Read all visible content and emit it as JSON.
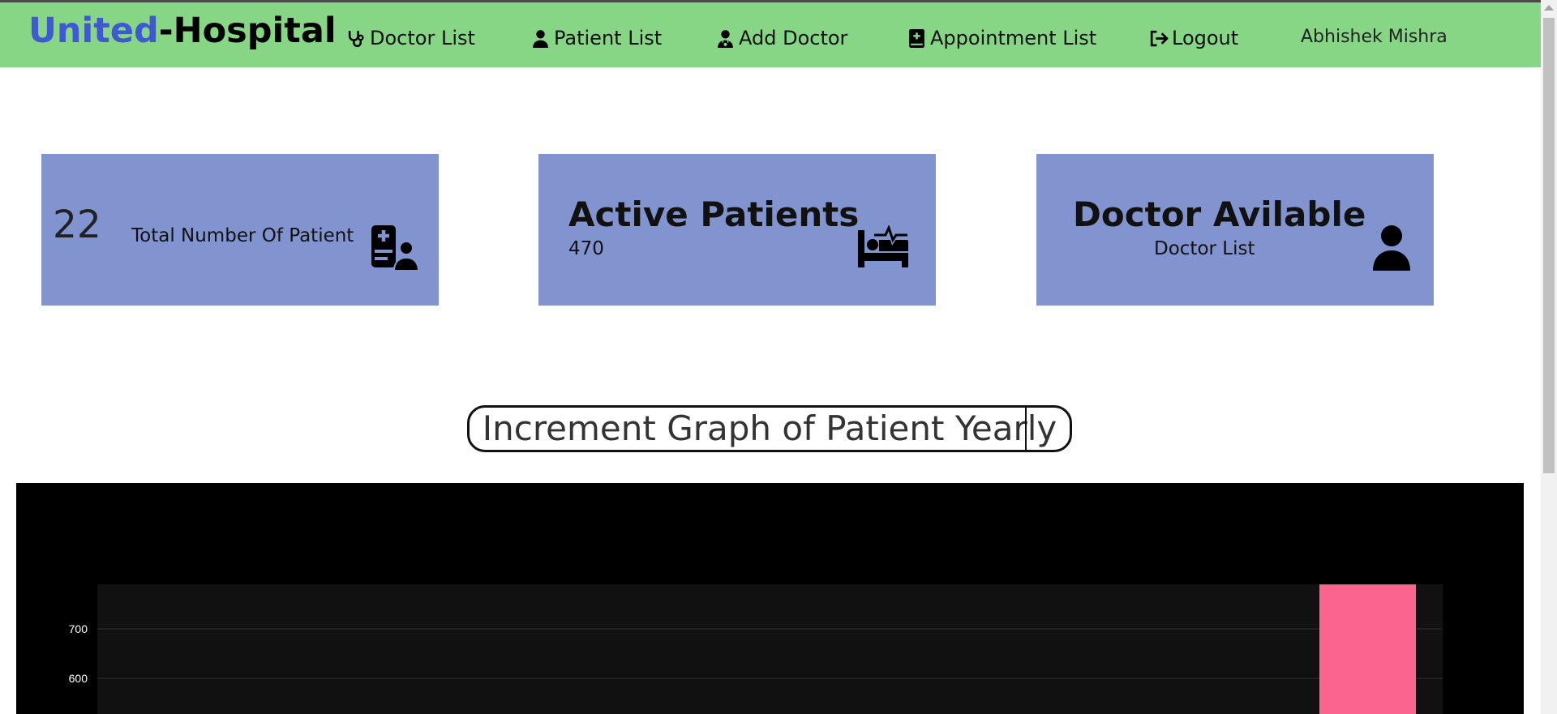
{
  "navbar": {
    "brand_part1": "United",
    "brand_part2": "-Hospital",
    "items": [
      {
        "label": "Doctor List",
        "icon": "stethoscope-icon"
      },
      {
        "label": "Patient List",
        "icon": "user-icon"
      },
      {
        "label": "Add Doctor",
        "icon": "user-doctor-icon"
      },
      {
        "label": "Appointment List",
        "icon": "medical-book-icon"
      },
      {
        "label": "Logout",
        "icon": "sign-out-icon"
      }
    ],
    "username": "Abhishek Mishra"
  },
  "cards": {
    "total_patients": {
      "value": "22",
      "label": "Total Number Of Patient",
      "icon": "hospital-user-icon"
    },
    "active_patients": {
      "title": "Active Patients",
      "value": "470",
      "icon": "bed-pulse-icon"
    },
    "doctor_available": {
      "title": "Doctor Avilable",
      "link": "Doctor List",
      "icon": "user-icon"
    }
  },
  "graph_title": "Increment Graph of Patient Yearly",
  "colors": {
    "navbar_bg": "#86d686",
    "brand_blue": "#3f58d3",
    "card_bg": "#8294cf",
    "chart_bg": "#000000",
    "plot_bg": "#111111",
    "bar_color": "#fc6490"
  },
  "chart_data": {
    "type": "bar",
    "y_ticks": [
      600,
      700
    ],
    "ylim_visible": [
      560,
      810
    ],
    "visible_bar_value": 790
  }
}
